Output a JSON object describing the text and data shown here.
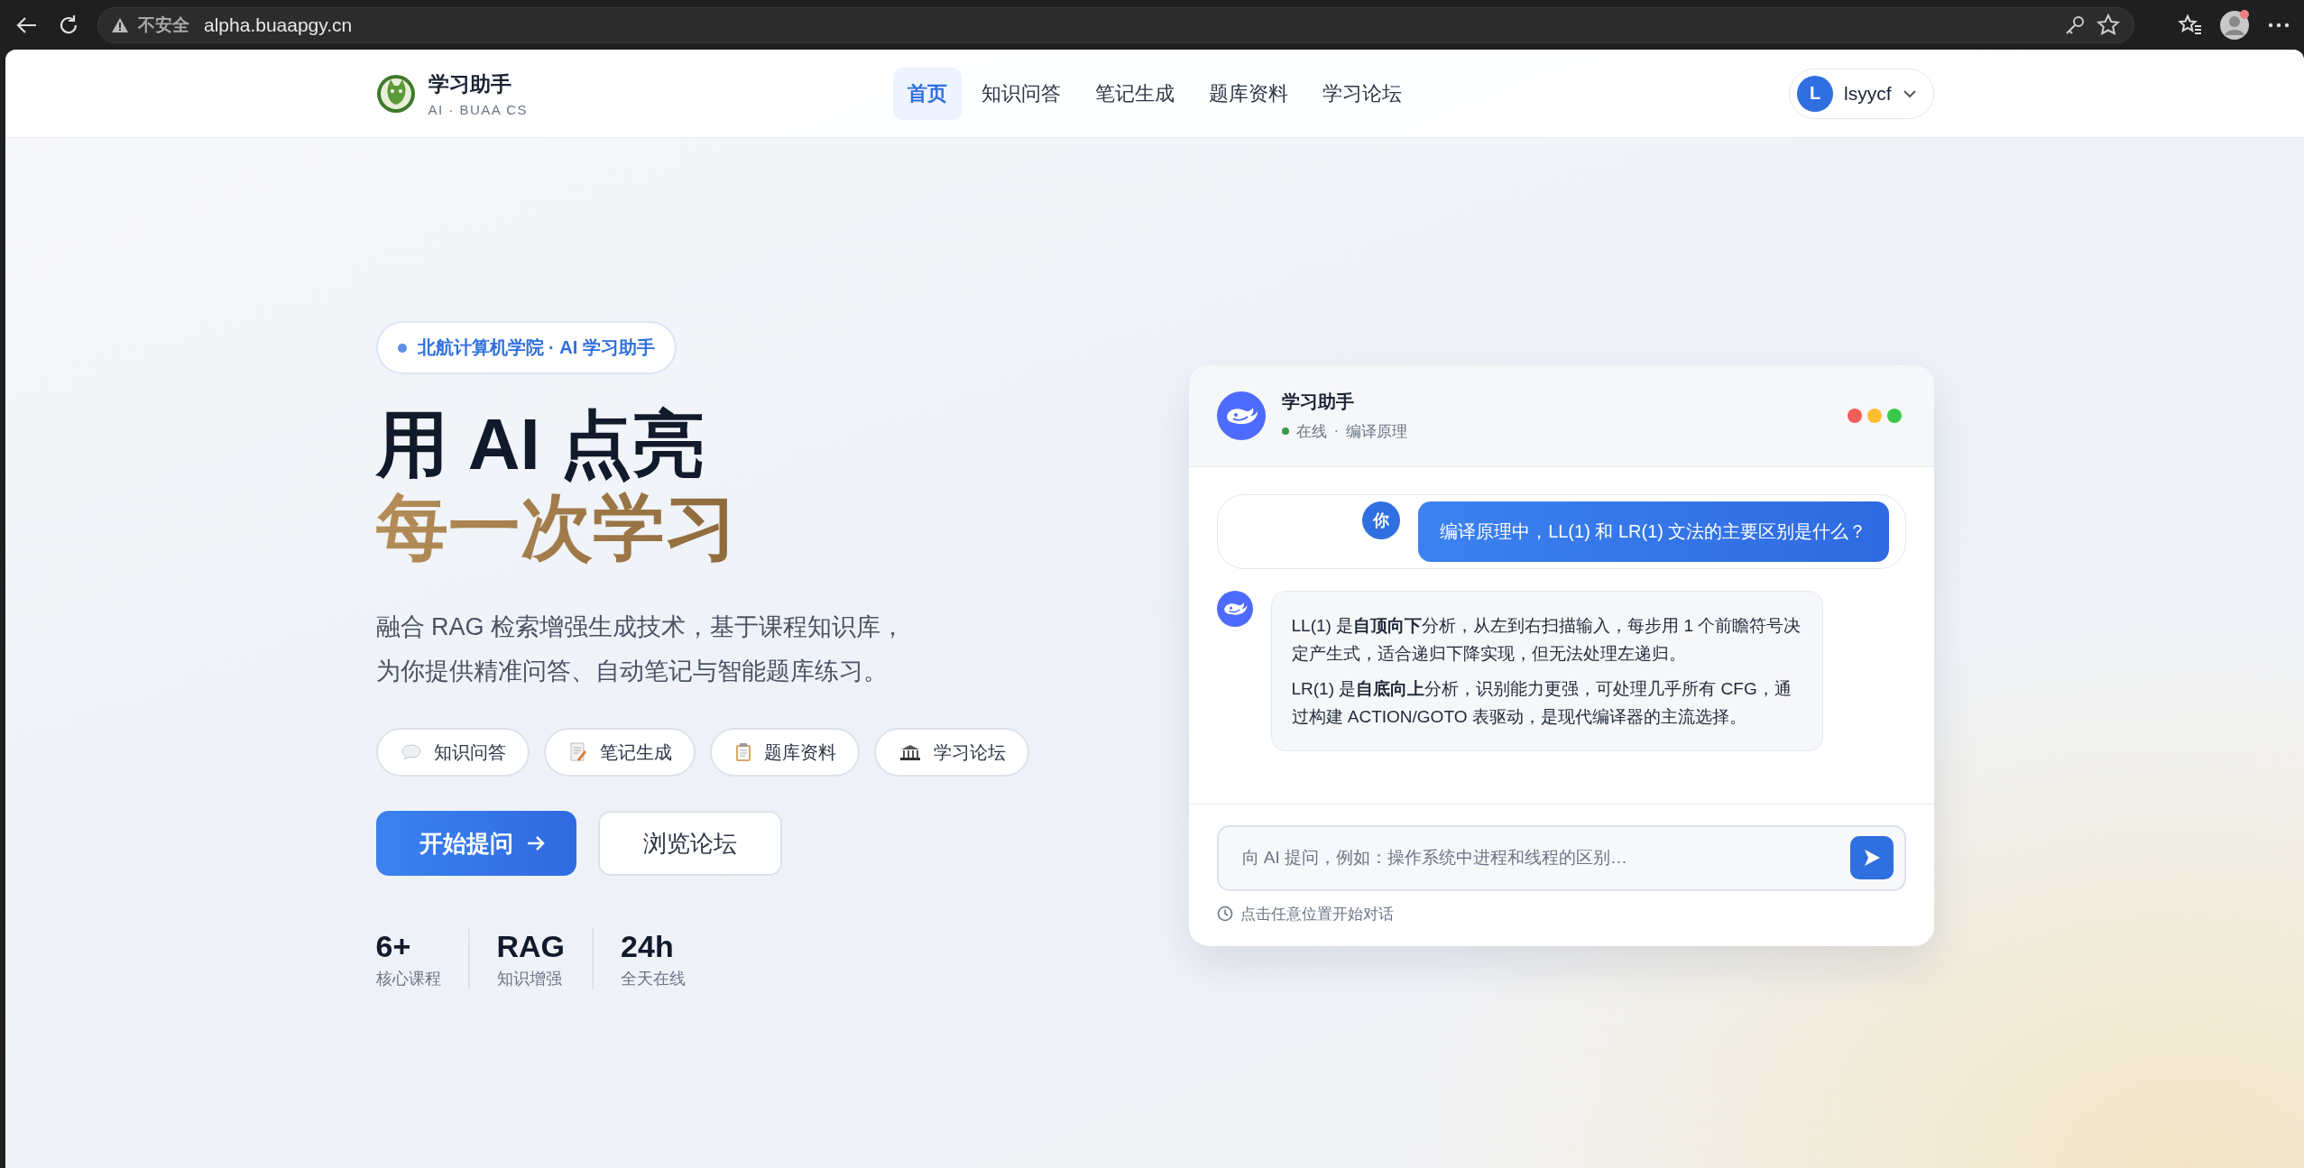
{
  "browser": {
    "security_label": "不安全",
    "url": "alpha.buaapgy.cn"
  },
  "nav": {
    "brand_title": "学习助手",
    "brand_subtitle": "AI · BUAA CS",
    "tabs": [
      {
        "label": "首页",
        "selected": true
      },
      {
        "label": "知识问答",
        "selected": false
      },
      {
        "label": "笔记生成",
        "selected": false
      },
      {
        "label": "题库资料",
        "selected": false
      },
      {
        "label": "学习论坛",
        "selected": false
      }
    ],
    "user": {
      "initial": "L",
      "name": "lsyycf"
    }
  },
  "hero": {
    "badge": "北航计算机学院 · AI 学习助手",
    "title_line_1": "用 AI 点亮",
    "title_line_2": "每一次学习",
    "description_lines": [
      "融合 RAG 检索增强生成技术，基于课程知识库，",
      "为你提供精准问答、自动笔记与智能题库练习。"
    ],
    "features": [
      {
        "kind": "chat",
        "label": "知识问答"
      },
      {
        "kind": "note",
        "label": "笔记生成"
      },
      {
        "kind": "clipboard",
        "label": "题库资料"
      },
      {
        "kind": "forum",
        "label": "学习论坛"
      }
    ],
    "primary_button": "开始提问",
    "secondary_button": "浏览论坛",
    "stats": [
      {
        "value": "6+",
        "label": "核心课程"
      },
      {
        "value": "RAG",
        "label": "知识增强"
      },
      {
        "value": "24h",
        "label": "全天在线"
      }
    ]
  },
  "chat": {
    "title": "学习助手",
    "online": true,
    "status": "在线",
    "separator": "·",
    "course": "编译原理",
    "messages": [
      {
        "kind": "user",
        "avatar": "你",
        "paragraphs": [
          "编译原理中，LL(1) 和 LR(1) 文法的主要区别是什么？"
        ]
      },
      {
        "kind": "assistant",
        "paragraphs": [
          "LL(1) 是**自顶向下**分析，从左到右扫描输入，每步用 1 个前瞻符号决定产生式，适合递归下降实现，但无法处理左递归。",
          "LR(1) 是**自底向上**分析，识别能力更强，可处理几乎所有 CFG，通过构建 ACTION/GOTO 表驱动，是现代编译器的主流选择。"
        ]
      }
    ],
    "input_placeholder": "向 AI 提问，例如：操作系统中进程和线程的区别…",
    "hint": "点击任意位置开始对话"
  }
}
